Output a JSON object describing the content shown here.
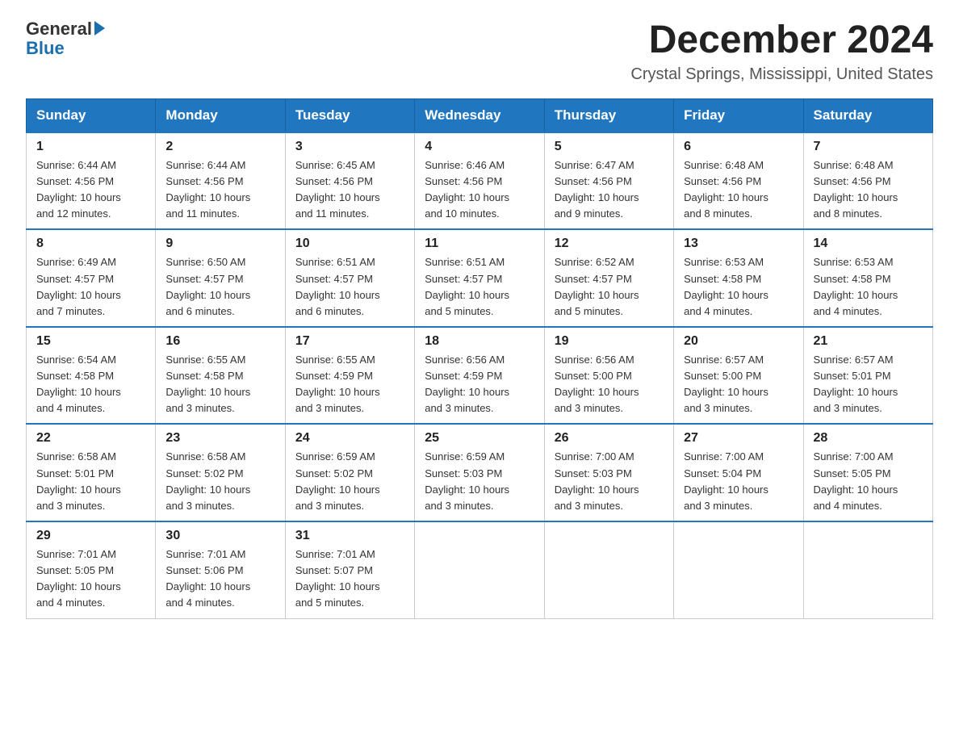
{
  "logo": {
    "text_general": "General",
    "text_blue": "Blue",
    "arrow": "▶"
  },
  "header": {
    "month_title": "December 2024",
    "location": "Crystal Springs, Mississippi, United States"
  },
  "days_of_week": [
    "Sunday",
    "Monday",
    "Tuesday",
    "Wednesday",
    "Thursday",
    "Friday",
    "Saturday"
  ],
  "weeks": [
    [
      {
        "day": "1",
        "sunrise": "6:44 AM",
        "sunset": "4:56 PM",
        "daylight": "10 hours and 12 minutes."
      },
      {
        "day": "2",
        "sunrise": "6:44 AM",
        "sunset": "4:56 PM",
        "daylight": "10 hours and 11 minutes."
      },
      {
        "day": "3",
        "sunrise": "6:45 AM",
        "sunset": "4:56 PM",
        "daylight": "10 hours and 11 minutes."
      },
      {
        "day": "4",
        "sunrise": "6:46 AM",
        "sunset": "4:56 PM",
        "daylight": "10 hours and 10 minutes."
      },
      {
        "day": "5",
        "sunrise": "6:47 AM",
        "sunset": "4:56 PM",
        "daylight": "10 hours and 9 minutes."
      },
      {
        "day": "6",
        "sunrise": "6:48 AM",
        "sunset": "4:56 PM",
        "daylight": "10 hours and 8 minutes."
      },
      {
        "day": "7",
        "sunrise": "6:48 AM",
        "sunset": "4:56 PM",
        "daylight": "10 hours and 8 minutes."
      }
    ],
    [
      {
        "day": "8",
        "sunrise": "6:49 AM",
        "sunset": "4:57 PM",
        "daylight": "10 hours and 7 minutes."
      },
      {
        "day": "9",
        "sunrise": "6:50 AM",
        "sunset": "4:57 PM",
        "daylight": "10 hours and 6 minutes."
      },
      {
        "day": "10",
        "sunrise": "6:51 AM",
        "sunset": "4:57 PM",
        "daylight": "10 hours and 6 minutes."
      },
      {
        "day": "11",
        "sunrise": "6:51 AM",
        "sunset": "4:57 PM",
        "daylight": "10 hours and 5 minutes."
      },
      {
        "day": "12",
        "sunrise": "6:52 AM",
        "sunset": "4:57 PM",
        "daylight": "10 hours and 5 minutes."
      },
      {
        "day": "13",
        "sunrise": "6:53 AM",
        "sunset": "4:58 PM",
        "daylight": "10 hours and 4 minutes."
      },
      {
        "day": "14",
        "sunrise": "6:53 AM",
        "sunset": "4:58 PM",
        "daylight": "10 hours and 4 minutes."
      }
    ],
    [
      {
        "day": "15",
        "sunrise": "6:54 AM",
        "sunset": "4:58 PM",
        "daylight": "10 hours and 4 minutes."
      },
      {
        "day": "16",
        "sunrise": "6:55 AM",
        "sunset": "4:58 PM",
        "daylight": "10 hours and 3 minutes."
      },
      {
        "day": "17",
        "sunrise": "6:55 AM",
        "sunset": "4:59 PM",
        "daylight": "10 hours and 3 minutes."
      },
      {
        "day": "18",
        "sunrise": "6:56 AM",
        "sunset": "4:59 PM",
        "daylight": "10 hours and 3 minutes."
      },
      {
        "day": "19",
        "sunrise": "6:56 AM",
        "sunset": "5:00 PM",
        "daylight": "10 hours and 3 minutes."
      },
      {
        "day": "20",
        "sunrise": "6:57 AM",
        "sunset": "5:00 PM",
        "daylight": "10 hours and 3 minutes."
      },
      {
        "day": "21",
        "sunrise": "6:57 AM",
        "sunset": "5:01 PM",
        "daylight": "10 hours and 3 minutes."
      }
    ],
    [
      {
        "day": "22",
        "sunrise": "6:58 AM",
        "sunset": "5:01 PM",
        "daylight": "10 hours and 3 minutes."
      },
      {
        "day": "23",
        "sunrise": "6:58 AM",
        "sunset": "5:02 PM",
        "daylight": "10 hours and 3 minutes."
      },
      {
        "day": "24",
        "sunrise": "6:59 AM",
        "sunset": "5:02 PM",
        "daylight": "10 hours and 3 minutes."
      },
      {
        "day": "25",
        "sunrise": "6:59 AM",
        "sunset": "5:03 PM",
        "daylight": "10 hours and 3 minutes."
      },
      {
        "day": "26",
        "sunrise": "7:00 AM",
        "sunset": "5:03 PM",
        "daylight": "10 hours and 3 minutes."
      },
      {
        "day": "27",
        "sunrise": "7:00 AM",
        "sunset": "5:04 PM",
        "daylight": "10 hours and 3 minutes."
      },
      {
        "day": "28",
        "sunrise": "7:00 AM",
        "sunset": "5:05 PM",
        "daylight": "10 hours and 4 minutes."
      }
    ],
    [
      {
        "day": "29",
        "sunrise": "7:01 AM",
        "sunset": "5:05 PM",
        "daylight": "10 hours and 4 minutes."
      },
      {
        "day": "30",
        "sunrise": "7:01 AM",
        "sunset": "5:06 PM",
        "daylight": "10 hours and 4 minutes."
      },
      {
        "day": "31",
        "sunrise": "7:01 AM",
        "sunset": "5:07 PM",
        "daylight": "10 hours and 5 minutes."
      },
      null,
      null,
      null,
      null
    ]
  ],
  "labels": {
    "sunrise": "Sunrise:",
    "sunset": "Sunset:",
    "daylight": "Daylight:"
  }
}
